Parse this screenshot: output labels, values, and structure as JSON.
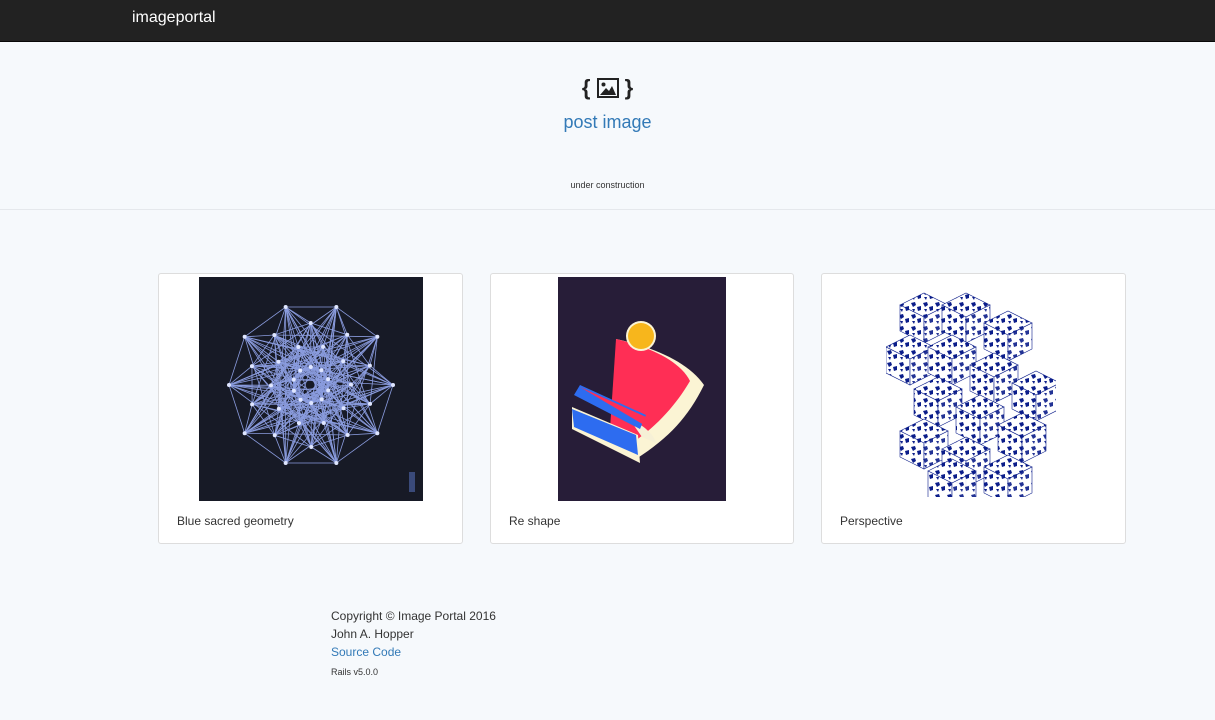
{
  "navbar": {
    "brand": "imageportal"
  },
  "hero": {
    "icon_open": "{",
    "icon_close": "}",
    "icon": "picture-icon",
    "post_link": "post image",
    "status": "under construction"
  },
  "cards": [
    {
      "caption": "Blue sacred geometry",
      "image": "sacred-geometry-image"
    },
    {
      "caption": "Re shape",
      "image": "reshape-image"
    },
    {
      "caption": "Perspective",
      "image": "perspective-cubes-image"
    }
  ],
  "footer": {
    "copyright": "Copyright © Image Portal 2016",
    "author": "John A. Hopper",
    "source_link": "Source Code",
    "version": "Rails v5.0.0"
  }
}
